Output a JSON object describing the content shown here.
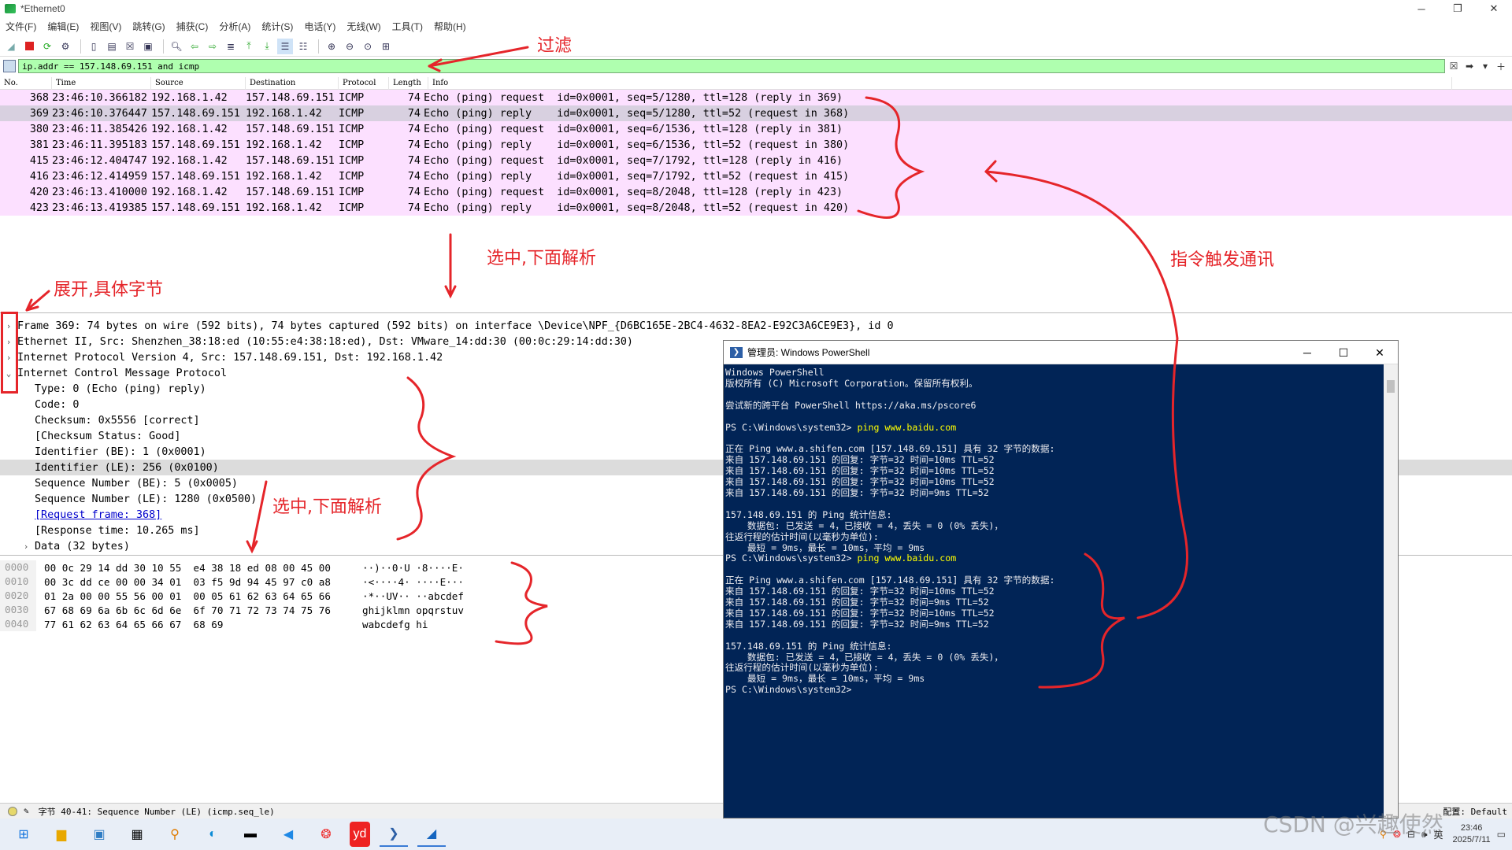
{
  "window": {
    "title": "*Ethernet0",
    "minimize": "─",
    "maximize": "❐",
    "close": "✕"
  },
  "menu": [
    "文件(F)",
    "编辑(E)",
    "视图(V)",
    "跳转(G)",
    "捕获(C)",
    "分析(A)",
    "统计(S)",
    "电话(Y)",
    "无线(W)",
    "工具(T)",
    "帮助(H)"
  ],
  "filter": {
    "value": "ip.addr == 157.148.69.151 and icmp"
  },
  "packet_list": {
    "columns": [
      "No.",
      "Time",
      "Source",
      "Destination",
      "Protocol",
      "Length",
      "Info"
    ],
    "rows": [
      {
        "no": "368",
        "time": "23:46:10.366182",
        "src": "192.168.1.42",
        "dst": "157.148.69.151",
        "proto": "ICMP",
        "len": "74",
        "info": "Echo (ping) request  id=0x0001, seq=5/1280, ttl=128 (reply in 369)"
      },
      {
        "no": "369",
        "time": "23:46:10.376447",
        "src": "157.148.69.151",
        "dst": "192.168.1.42",
        "proto": "ICMP",
        "len": "74",
        "info": "Echo (ping) reply    id=0x0001, seq=5/1280, ttl=52 (request in 368)"
      },
      {
        "no": "380",
        "time": "23:46:11.385426",
        "src": "192.168.1.42",
        "dst": "157.148.69.151",
        "proto": "ICMP",
        "len": "74",
        "info": "Echo (ping) request  id=0x0001, seq=6/1536, ttl=128 (reply in 381)"
      },
      {
        "no": "381",
        "time": "23:46:11.395183",
        "src": "157.148.69.151",
        "dst": "192.168.1.42",
        "proto": "ICMP",
        "len": "74",
        "info": "Echo (ping) reply    id=0x0001, seq=6/1536, ttl=52 (request in 380)"
      },
      {
        "no": "415",
        "time": "23:46:12.404747",
        "src": "192.168.1.42",
        "dst": "157.148.69.151",
        "proto": "ICMP",
        "len": "74",
        "info": "Echo (ping) request  id=0x0001, seq=7/1792, ttl=128 (reply in 416)"
      },
      {
        "no": "416",
        "time": "23:46:12.414959",
        "src": "157.148.69.151",
        "dst": "192.168.1.42",
        "proto": "ICMP",
        "len": "74",
        "info": "Echo (ping) reply    id=0x0001, seq=7/1792, ttl=52 (request in 415)"
      },
      {
        "no": "420",
        "time": "23:46:13.410000",
        "src": "192.168.1.42",
        "dst": "157.148.69.151",
        "proto": "ICMP",
        "len": "74",
        "info": "Echo (ping) request  id=0x0001, seq=8/2048, ttl=128 (reply in 423)"
      },
      {
        "no": "423",
        "time": "23:46:13.419385",
        "src": "157.148.69.151",
        "dst": "192.168.1.42",
        "proto": "ICMP",
        "len": "74",
        "info": "Echo (ping) reply    id=0x0001, seq=8/2048, ttl=52 (request in 420)"
      }
    ]
  },
  "details": {
    "top": [
      "Frame 369: 74 bytes on wire (592 bits), 74 bytes captured (592 bits) on interface \\Device\\NPF_{D6BC165E-2BC4-4632-8EA2-E92C3A6CE9E3}, id 0",
      "Ethernet II, Src: Shenzhen_38:18:ed (10:55:e4:38:18:ed), Dst: VMware_14:dd:30 (00:0c:29:14:dd:30)",
      "Internet Protocol Version 4, Src: 157.148.69.151, Dst: 192.168.1.42",
      "Internet Control Message Protocol"
    ],
    "icmp": [
      "Type: 0 (Echo (ping) reply)",
      "Code: 0",
      "Checksum: 0x5556 [correct]",
      "[Checksum Status: Good]",
      "Identifier (BE): 1 (0x0001)",
      "Identifier (LE): 256 (0x0100)",
      "Sequence Number (BE): 5 (0x0005)",
      "Sequence Number (LE): 1280 (0x0500)"
    ],
    "request_frame": "[Request frame: 368]",
    "response_time": "[Response time: 10.265 ms]",
    "data": "Data (32 bytes)"
  },
  "bytes": [
    {
      "off": "0000",
      "hex": "00 0c 29 14 dd 30 10 55  e4 38 18 ed 08 00 45 00",
      "asc": "··)··0·U ·8····E·"
    },
    {
      "off": "0010",
      "hex": "00 3c dd ce 00 00 34 01  03 f5 9d 94 45 97 c0 a8",
      "asc": "·<····4· ····E···"
    },
    {
      "off": "0020",
      "hex": "01 2a 00 00 55 56 00 01  00 05 61 62 63 64 65 66",
      "asc": "·*··UV·· ··abcdef"
    },
    {
      "off": "0030",
      "hex": "67 68 69 6a 6b 6c 6d 6e  6f 70 71 72 73 74 75 76",
      "asc": "ghijklmn opqrstuv"
    },
    {
      "off": "0040",
      "hex": "77 61 62 63 64 65 66 67  68 69",
      "asc": "wabcdefg hi"
    }
  ],
  "status": {
    "text": "字节 40-41: Sequence Number (LE) (icmp.seq_le)",
    "profile": "配置: Default"
  },
  "powershell": {
    "title": "管理员: Windows PowerShell",
    "lines": [
      "Windows PowerShell",
      "版权所有 (C) Microsoft Corporation。保留所有权利。",
      "",
      "尝试新的跨平台 PowerShell https://aka.ms/pscore6",
      "",
      "PS C:\\Windows\\system32> |ping www.baidu.com",
      "",
      "正在 Ping www.a.shifen.com [157.148.69.151] 具有 32 字节的数据:",
      "来自 157.148.69.151 的回复: 字节=32 时间=10ms TTL=52",
      "来自 157.148.69.151 的回复: 字节=32 时间=10ms TTL=52",
      "来自 157.148.69.151 的回复: 字节=32 时间=10ms TTL=52",
      "来自 157.148.69.151 的回复: 字节=32 时间=9ms TTL=52",
      "",
      "157.148.69.151 的 Ping 统计信息:",
      "    数据包: 已发送 = 4，已接收 = 4，丢失 = 0 (0% 丢失)，",
      "往返行程的估计时间(以毫秒为单位):",
      "    最短 = 9ms，最长 = 10ms，平均 = 9ms",
      "PS C:\\Windows\\system32> |ping www.baidu.com",
      "",
      "正在 Ping www.a.shifen.com [157.148.69.151] 具有 32 字节的数据:",
      "来自 157.148.69.151 的回复: 字节=32 时间=10ms TTL=52",
      "来自 157.148.69.151 的回复: 字节=32 时间=9ms TTL=52",
      "来自 157.148.69.151 的回复: 字节=32 时间=10ms TTL=52",
      "来自 157.148.69.151 的回复: 字节=32 时间=9ms TTL=52",
      "",
      "157.148.69.151 的 Ping 统计信息:",
      "    数据包: 已发送 = 4，已接收 = 4，丢失 = 0 (0% 丢失)，",
      "往返行程的估计时间(以毫秒为单位):",
      "    最短 = 9ms，最长 = 10ms，平均 = 9ms",
      "PS C:\\Windows\\system32>"
    ]
  },
  "annotations": {
    "filter": "过滤",
    "select_parse_1": "选中,下面解析",
    "expand": "展开,具体字节",
    "command": "指令触发通讯",
    "select_parse_2": "选中,下面解析"
  },
  "taskbar": {
    "clock_time": "23:46",
    "clock_date": "2025/7/11",
    "lang": "英"
  },
  "watermark": "CSDN @兴趣使然"
}
